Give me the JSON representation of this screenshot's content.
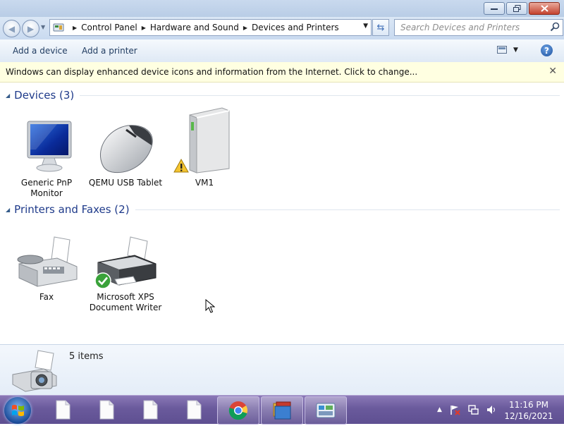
{
  "breadcrumb": [
    "Control Panel",
    "Hardware and Sound",
    "Devices and Printers"
  ],
  "search": {
    "placeholder": "Search Devices and Printers"
  },
  "commands": {
    "add_device": "Add a device",
    "add_printer": "Add a printer"
  },
  "infobar": {
    "text": "Windows can display enhanced device icons and information from the Internet. Click to change..."
  },
  "groups": {
    "devices": {
      "title": "Devices (3)",
      "items": [
        {
          "label": "Generic PnP Monitor",
          "icon": "monitor-icon"
        },
        {
          "label": "QEMU USB Tablet",
          "icon": "mouse-icon"
        },
        {
          "label": "VM1",
          "icon": "computer-tower-icon",
          "badge": "warning-icon"
        }
      ]
    },
    "printers": {
      "title": "Printers and Faxes (2)",
      "items": [
        {
          "label": "Fax",
          "icon": "fax-icon"
        },
        {
          "label": "Microsoft XPS Document Writer",
          "icon": "printer-icon",
          "badge": "default-check-icon"
        }
      ]
    }
  },
  "details": {
    "count": "5 items"
  },
  "taskbar": {
    "time": "11:16 PM",
    "date": "12/16/2021",
    "items": [
      "file-icon",
      "file-icon",
      "file-icon",
      "file-icon",
      "chrome-icon",
      "windows-explorer-icon",
      "devices-and-printers-icon"
    ]
  },
  "colors": {
    "accent": "#1e3a8a",
    "infobar": "#ffffe1",
    "taskbar": "#6a5a9c"
  }
}
